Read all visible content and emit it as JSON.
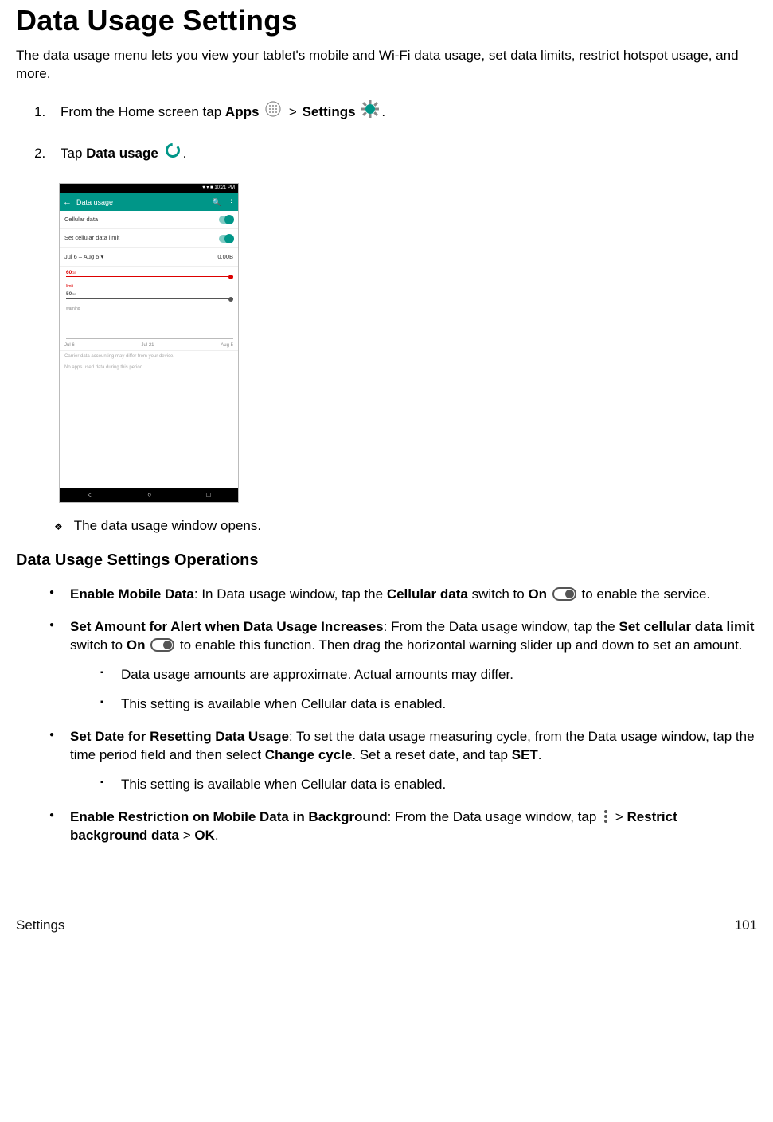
{
  "heading": "Data Usage Settings",
  "intro": "The data usage menu lets you view your tablet's mobile and Wi-Fi data usage, set data limits, restrict hotspot usage, and more.",
  "step1_pre": "From the Home screen tap ",
  "step1_apps": "Apps",
  "step1_gt": ">",
  "step1_settings": "Settings",
  "period": ".",
  "step2_pre": "Tap ",
  "step2_bold": "Data usage",
  "screenshot": {
    "status_time": "10:21 PM",
    "header_title": "Data usage",
    "row_cellular": "Cellular data",
    "row_setlimit": "Set cellular data limit",
    "range_label": "Jul 6 – Aug 5",
    "range_dropdown": "▾",
    "range_value": "0.00B",
    "slider_60": "60",
    "slider_gb1": "GB",
    "slider_limit": "limit",
    "slider_50": "50",
    "slider_gb2": "GB",
    "slider_warn": "warning",
    "axis_a": "Jul 6",
    "axis_b": "Jul 21",
    "axis_c": "Aug 5",
    "note1": "Carrier data accounting may differ from your device.",
    "note2": "No apps used data during this period.",
    "nav_back": "◁",
    "nav_home": "○",
    "nav_recent": "□"
  },
  "sub_bullet": "The data usage window opens.",
  "subhead": "Data Usage Settings Operations",
  "b1_title": "Enable Mobile Data",
  "b1_text_a": ": In Data usage window, tap the ",
  "b1_bold_a": "Cellular data",
  "b1_text_b": " switch to ",
  "b1_bold_b": "On",
  "b1_text_c": " to enable the service.",
  "b2_title": "Set Amount for Alert when Data Usage Increases",
  "b2_text_a": ": From the Data usage window, tap the ",
  "b2_bold_a": "Set cellular data limit",
  "b2_text_b": " switch to ",
  "b2_bold_b": "On",
  "b2_text_c": " to enable this function. Then drag the horizontal warning slider up and down to set an amount.",
  "b2_sub1": "Data usage amounts are approximate. Actual amounts may differ.",
  "b2_sub2": "This setting is available when Cellular data is enabled.",
  "b3_title": "Set Date for Resetting Data Usage",
  "b3_text_a": ": To set the data usage measuring cycle, from the Data usage window, tap the time period field and then select ",
  "b3_bold_a": "Change cycle",
  "b3_text_b": ". Set a reset date, and tap ",
  "b3_bold_b": "SET",
  "b3_sub1": "This setting is available when Cellular data is enabled.",
  "b4_title": "Enable Restriction on Mobile Data in Background",
  "b4_text_a": ": From the Data usage window, tap ",
  "b4_gt": ">",
  "b4_bold_a": "Restrict background data",
  "b4_gt2": ">",
  "b4_bold_b": "OK",
  "footer_left": "Settings",
  "footer_right": "101"
}
